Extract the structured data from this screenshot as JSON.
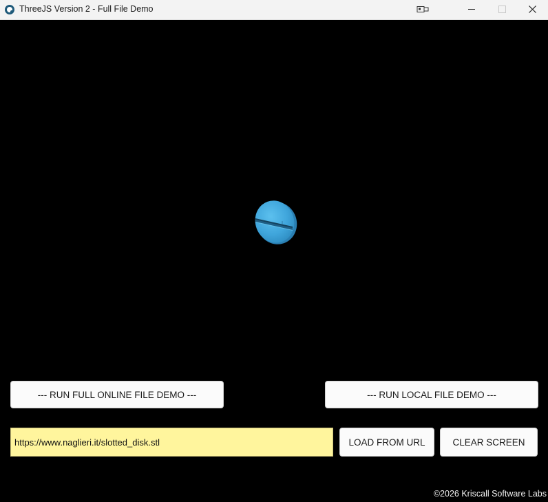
{
  "window": {
    "title": "ThreeJS Version 2 - Full File Demo",
    "controls": {
      "screenshot_icon": "screenshot-icon",
      "minimize_icon": "minimize-icon",
      "maximize_icon": "maximize-icon",
      "close_icon": "close-icon"
    }
  },
  "scene": {
    "background": "#000000",
    "model_color": "#3fa3d9",
    "model": "slotted-disk"
  },
  "buttons": {
    "online_demo": "--- RUN FULL ONLINE FILE DEMO ---",
    "local_demo": "--- RUN LOCAL FILE DEMO ---",
    "load_from_url": "LOAD FROM URL",
    "clear_screen": "CLEAR SCREEN"
  },
  "url_field": {
    "value": "https://www.naglieri.it/slotted_disk.stl",
    "background": "#fff59d"
  },
  "footer": {
    "copyright": "©2026 Kriscall Software Labs"
  }
}
